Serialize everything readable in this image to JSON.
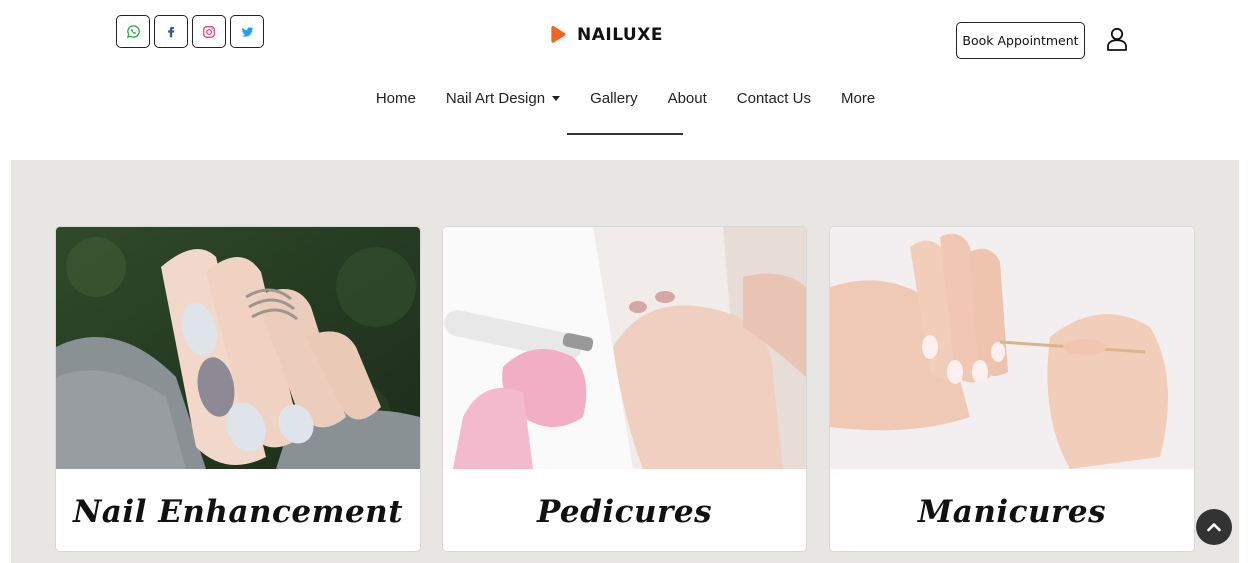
{
  "header": {
    "social": [
      {
        "name": "whatsapp-icon",
        "color": "#25a244"
      },
      {
        "name": "facebook-icon",
        "color": "#3b5998"
      },
      {
        "name": "instagram-icon",
        "color": "#e1306c"
      },
      {
        "name": "twitter-icon",
        "color": "#1da1f2"
      }
    ],
    "brand": "NAILUXE",
    "brand_color": "#f26522",
    "book_label": "Book Appointment"
  },
  "nav": {
    "items": [
      "Home",
      "Nail Art Design",
      "Gallery",
      "About",
      "Contact Us",
      "More"
    ]
  },
  "services": [
    {
      "title": "Nail Enhancement"
    },
    {
      "title": "Pedicures"
    },
    {
      "title": "Manicures"
    }
  ]
}
